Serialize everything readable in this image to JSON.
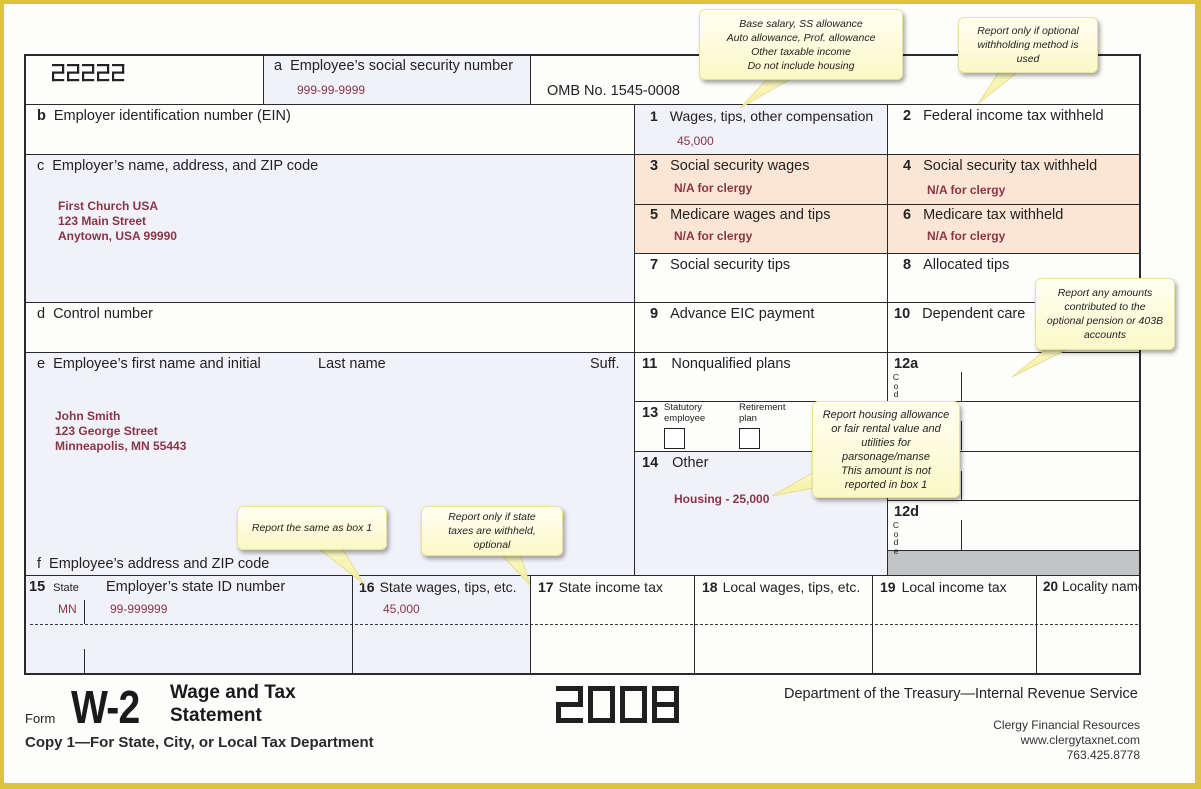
{
  "form": {
    "control_code": "22222",
    "omb": "OMB No. 1545-0008",
    "form_word": "Form",
    "form_number": "W-2",
    "form_title_line1": "Wage and Tax",
    "form_title_line2": "Statement",
    "year": "2008",
    "copy_note": "Copy 1—For State, City, or Local Tax Department",
    "department": "Department of the Treasury—Internal Revenue Service"
  },
  "brand": {
    "name": "Clergy Financial Resources",
    "website": "www.clergytaxnet.com",
    "phone": "763.425.8778"
  },
  "boxes": {
    "a": {
      "key": "a",
      "label": "Employee’s social security number",
      "value": "999-99-9999"
    },
    "b": {
      "key": "b",
      "label": "Employer identification number (EIN)"
    },
    "c": {
      "key": "c",
      "label": "Employer’s name, address, and ZIP code",
      "lines": [
        "First Church USA",
        "123 Main Street",
        "Anytown, USA  99990"
      ]
    },
    "d": {
      "key": "d",
      "label": "Control number"
    },
    "e": {
      "key": "e",
      "label": "Employee’s first name and initial",
      "last_name_label": "Last name",
      "suffix_label": "Suff.",
      "lines": [
        "John Smith",
        "123 George Street",
        "Minneapolis, MN 55443"
      ]
    },
    "f": {
      "key": "f",
      "label": "Employee’s address and ZIP code"
    },
    "b1": {
      "key": "1",
      "label": "Wages, tips, other compensation",
      "value": "45,000"
    },
    "b2": {
      "key": "2",
      "label": "Federal income tax withheld"
    },
    "b3": {
      "key": "3",
      "label": "Social security wages",
      "value": "N/A for clergy"
    },
    "b4": {
      "key": "4",
      "label": "Social security tax withheld",
      "value": "N/A for clergy"
    },
    "b5": {
      "key": "5",
      "label": "Medicare wages and tips",
      "value": "N/A for clergy"
    },
    "b6": {
      "key": "6",
      "label": "Medicare tax withheld",
      "value": "N/A for clergy"
    },
    "b7": {
      "key": "7",
      "label": "Social security tips"
    },
    "b8": {
      "key": "8",
      "label": "Allocated tips"
    },
    "b9": {
      "key": "9",
      "label": "Advance EIC payment"
    },
    "b10": {
      "key": "10",
      "label": "Dependent care"
    },
    "b11": {
      "key": "11",
      "label": "Nonqualified plans"
    },
    "b12a": {
      "key": "12a",
      "code_label": "C o d e"
    },
    "b12d": {
      "key": "12d",
      "code_label": "C o d e"
    },
    "b13": {
      "key": "13",
      "statutory_label": "Statutory employee",
      "retirement_label": "Retirement plan",
      "statutory_checked": false,
      "retirement_checked": false
    },
    "b14": {
      "key": "14",
      "label": "Other",
      "value": "Housing - 25,000"
    },
    "b15": {
      "key": "15",
      "state_label": "State",
      "id_label": "Employer’s state ID number",
      "state_value": "MN",
      "id_value": "99-999999"
    },
    "b16": {
      "key": "16",
      "label": "State wages, tips, etc.",
      "value": "45,000"
    },
    "b17": {
      "key": "17",
      "label": "State income tax"
    },
    "b18": {
      "key": "18",
      "label": "Local wages, tips, etc."
    },
    "b19": {
      "key": "19",
      "label": "Local income tax"
    },
    "b20": {
      "key": "20",
      "label": "Locality name"
    }
  },
  "callouts": {
    "box1": [
      "Base salary, SS allowance",
      "Auto allowance, Prof. allowance",
      "Other taxable income",
      "Do not include housing"
    ],
    "box2": [
      "Report only if optional",
      "withholding method is",
      "used"
    ],
    "box12": [
      "Report any amounts",
      "contributed to the",
      "optional pension or 403B",
      "accounts"
    ],
    "box14": [
      "Report housing allowance",
      "or fair rental value and",
      "utilities for",
      "parsonage/manse",
      "This amount is not",
      "reported in box 1"
    ],
    "box16": [
      "Report the same as box 1"
    ],
    "box17": [
      "Report only if  state",
      "taxes are withheld,",
      "optional"
    ]
  },
  "colors": {
    "frame": "#dcc43c",
    "value_text": "#8a3545",
    "tint_blue": "#f1f1fa",
    "tint_peach": "#fbe6d6",
    "callout": "#fbf8c8"
  }
}
